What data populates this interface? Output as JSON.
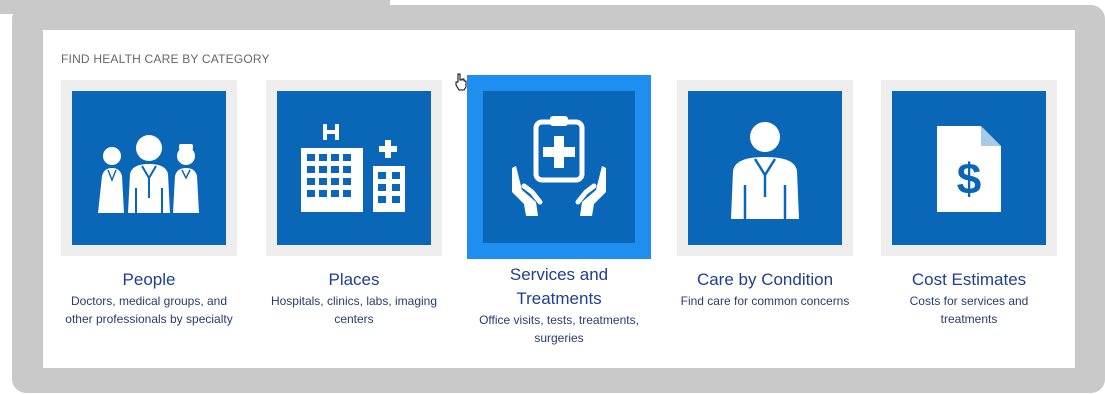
{
  "section": {
    "title": "FIND HEALTH CARE BY CATEGORY"
  },
  "categories": [
    {
      "title": "People",
      "description": "Doctors, medical groups, and other professionals by specialty",
      "icon": "doctors-icon"
    },
    {
      "title": "Places",
      "description": "Hospitals, clinics, labs, imaging centers",
      "icon": "hospital-icon"
    },
    {
      "title": "Services and Treatments",
      "description": "Office visits, tests, treatments, surgeries",
      "icon": "care-clipboard-icon"
    },
    {
      "title": "Care by Condition",
      "description": "Find care for common concerns",
      "icon": "doctor-icon"
    },
    {
      "title": "Cost Estimates",
      "description": "Costs for services and treatments",
      "icon": "cost-document-icon"
    }
  ],
  "colors": {
    "tile_blue": "#0a67b8",
    "tile_highlight": "#1e8ff0",
    "title_text": "#1f3f8f"
  }
}
